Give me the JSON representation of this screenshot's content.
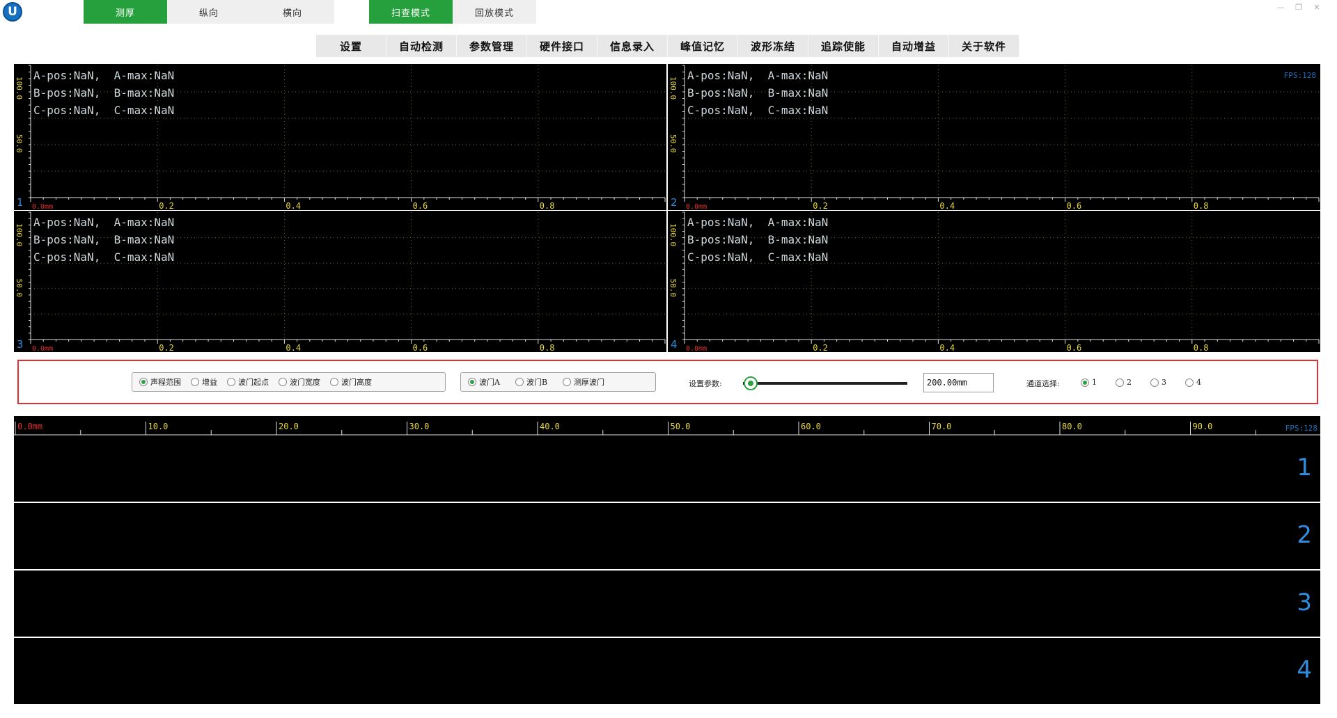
{
  "logo": {
    "letter": "U"
  },
  "mode_tabs": [
    "测厚",
    "纵向",
    "横向"
  ],
  "view_tabs": [
    "扫查模式",
    "回放模式"
  ],
  "menu": [
    "设置",
    "自动检测",
    "参数管理",
    "硬件接口",
    "信息录入",
    "峰值记忆",
    "波形冻结",
    "追踪使能",
    "自动增益",
    "关于软件"
  ],
  "scopes": [
    {
      "channel": "1",
      "lines": [
        "A-pos:NaN,  A-max:NaN",
        "B-pos:NaN,  B-max:NaN",
        "C-pos:NaN,  C-max:NaN"
      ],
      "fps": ""
    },
    {
      "channel": "2",
      "lines": [
        "A-pos:NaN,  A-max:NaN",
        "B-pos:NaN,  B-max:NaN",
        "C-pos:NaN,  C-max:NaN"
      ],
      "fps": "FPS:128"
    },
    {
      "channel": "3",
      "lines": [
        "A-pos:NaN,  A-max:NaN",
        "B-pos:NaN,  B-max:NaN",
        "C-pos:NaN,  C-max:NaN"
      ],
      "fps": ""
    },
    {
      "channel": "4",
      "lines": [
        "A-pos:NaN,  A-max:NaN",
        "B-pos:NaN,  B-max:NaN",
        "C-pos:NaN,  C-max:NaN"
      ],
      "fps": ""
    }
  ],
  "scope_axis": {
    "x_ticks": [
      "0.0mm",
      "0.2",
      "0.4",
      "0.6",
      "0.8"
    ],
    "y_ticks": [
      "100.0",
      "50.0"
    ]
  },
  "controls": {
    "param_group": [
      {
        "label": "声程范围",
        "checked": true
      },
      {
        "label": "增益",
        "checked": false
      },
      {
        "label": "波门起点",
        "checked": false
      },
      {
        "label": "波门宽度",
        "checked": false
      },
      {
        "label": "波门高度",
        "checked": false
      }
    ],
    "gate_group": [
      {
        "label": "波门A",
        "checked": true
      },
      {
        "label": "波门B",
        "checked": false
      },
      {
        "label": "测厚波门",
        "checked": false
      }
    ],
    "set_param_label": "设置参数:",
    "slider_level": 0.0,
    "param_value": "200.00mm",
    "channel_label": "通道选择:",
    "channel_options": [
      {
        "label": "1",
        "checked": true
      },
      {
        "label": "2",
        "checked": false
      },
      {
        "label": "3",
        "checked": false
      },
      {
        "label": "4",
        "checked": false
      }
    ]
  },
  "scan": {
    "ruler_ticks": [
      "0.0mm",
      "10.0",
      "20.0",
      "30.0",
      "40.0",
      "50.0",
      "60.0",
      "70.0",
      "80.0",
      "90.0"
    ],
    "fps": "FPS:128",
    "rows": [
      "1",
      "2",
      "3",
      "4"
    ]
  }
}
